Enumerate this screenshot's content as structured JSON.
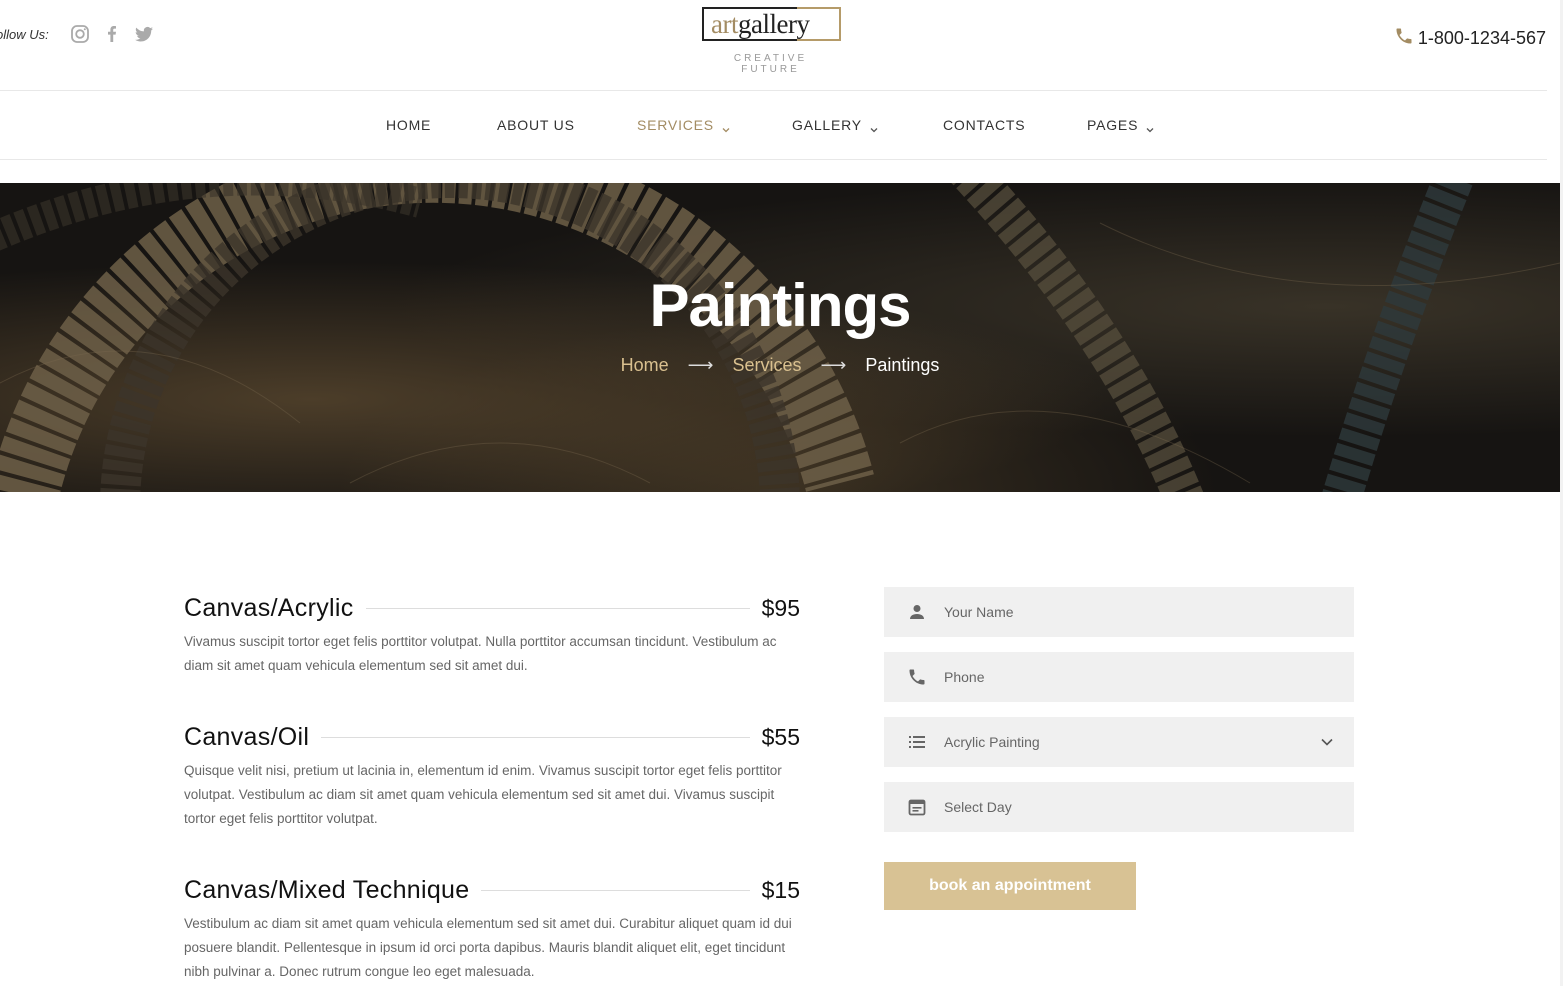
{
  "header": {
    "follow_label": "ollow Us:",
    "social_icons": [
      "instagram-icon",
      "facebook-icon",
      "twitter-icon"
    ],
    "logo_art": "art",
    "logo_gallery": "gallery",
    "tagline": "CREATIVE FUTURE",
    "phone": "1-800-1234-567"
  },
  "nav": {
    "home": "HOME",
    "about": "ABOUT US",
    "services": "SERVICES",
    "gallery": "GALLERY",
    "contacts": "CONTACTS",
    "pages": "PAGES",
    "active": "SERVICES"
  },
  "hero": {
    "title": "Paintings",
    "breadcrumb": [
      "Home",
      "Services",
      "Paintings"
    ]
  },
  "services": [
    {
      "title": "Canvas/Acrylic",
      "price": "$95",
      "description": "Vivamus suscipit tortor eget felis porttitor volutpat. Nulla porttitor accumsan tincidunt. Vestibulum ac diam sit amet quam vehicula elementum sed sit amet dui."
    },
    {
      "title": "Canvas/Oil",
      "price": "$55",
      "description": "Quisque velit nisi, pretium ut lacinia in, elementum id enim. Vivamus suscipit tortor eget felis porttitor volutpat. Vestibulum ac diam sit amet quam vehicula elementum sed sit amet dui. Vivamus suscipit tortor eget felis porttitor volutpat."
    },
    {
      "title": "Canvas/Mixed Technique",
      "price": "$15",
      "description": "Vestibulum ac diam sit amet quam vehicula elementum sed sit amet dui. Curabitur aliquet quam id dui posuere blandit. Pellentesque in ipsum id orci porta dapibus. Mauris blandit aliquet elit, eget tincidunt nibh pulvinar a. Donec rutrum congue leo eget malesuada."
    }
  ],
  "form": {
    "name_placeholder": "Your Name",
    "phone_placeholder": "Phone",
    "service_selected": "Acrylic Painting",
    "day_placeholder": "Select Day",
    "submit_label": "book an appointment"
  },
  "colors": {
    "accent": "#a38c63",
    "button": "#d8c294",
    "field_bg": "#f0f0f0"
  }
}
